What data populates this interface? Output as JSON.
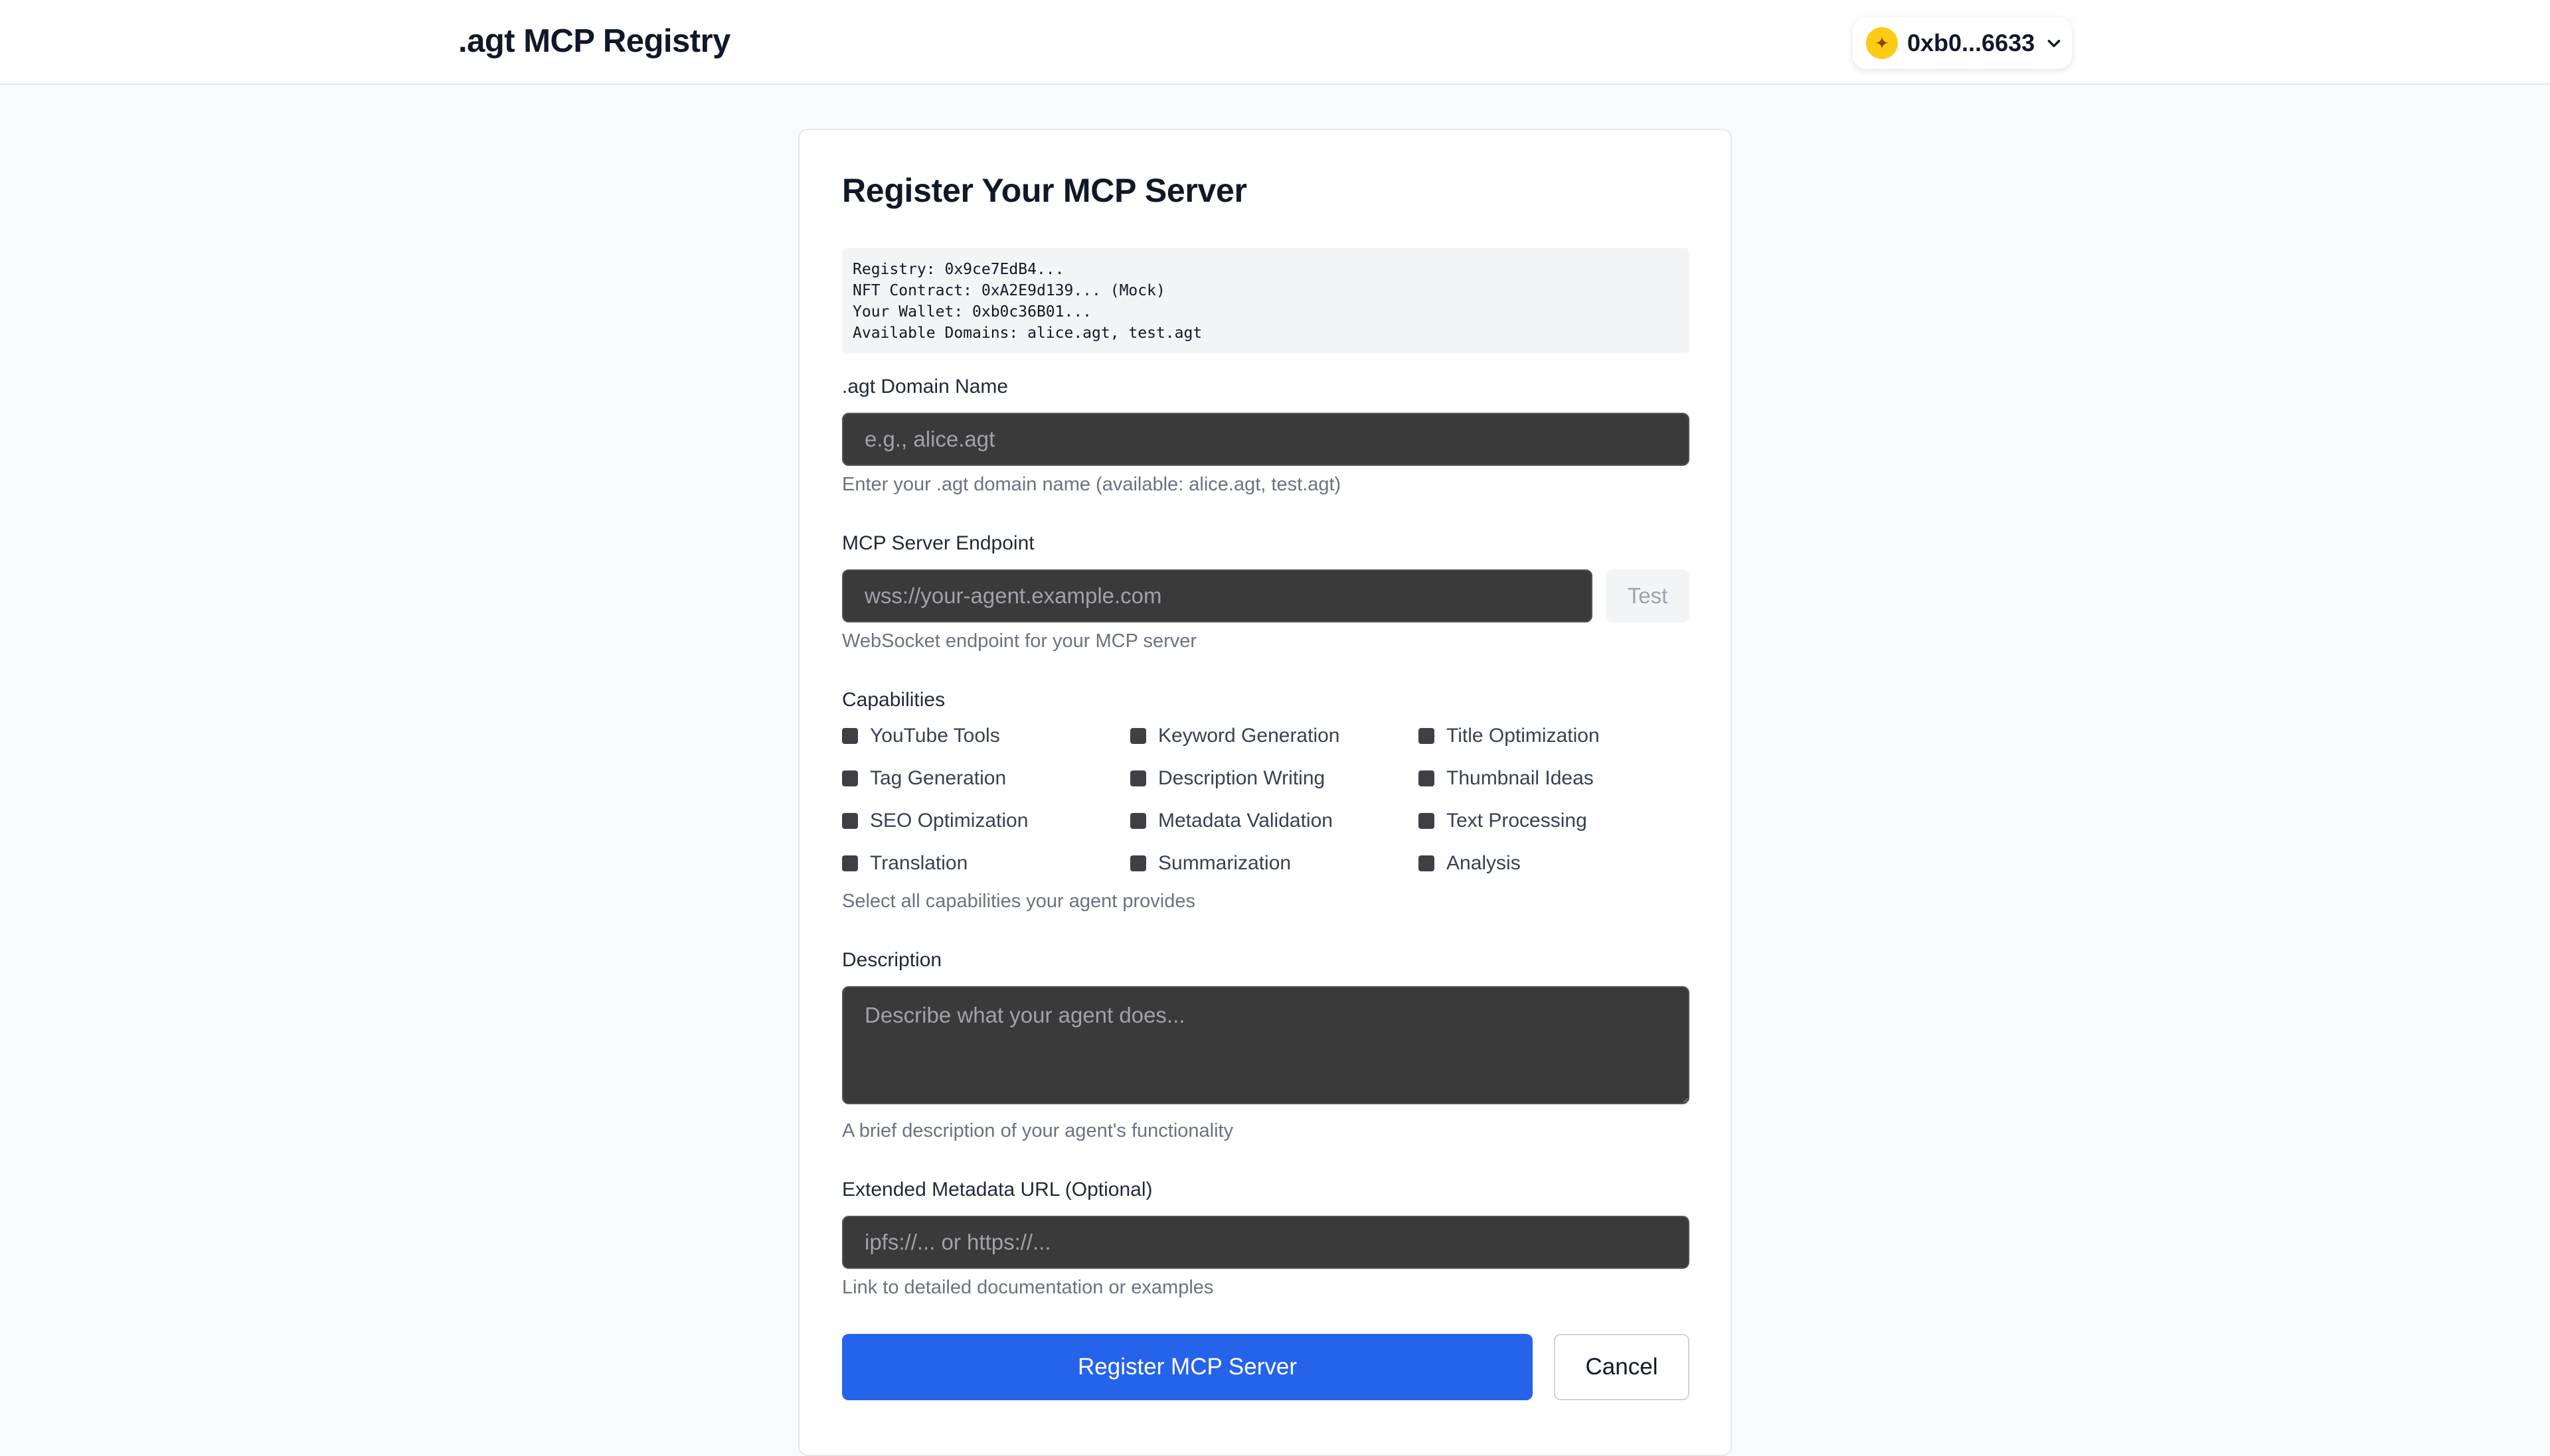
{
  "header": {
    "title": ".agt MCP Registry",
    "wallet": {
      "avatar_icon": "avatar-icon",
      "address": "0xb0...6633",
      "chevron_icon": "chevron-down-icon"
    }
  },
  "form": {
    "title": "Register Your MCP Server",
    "info_lines": [
      "Registry: 0x9ce7EdB4...",
      "NFT Contract: 0xA2E9d139... (Mock)",
      "Your Wallet: 0xb0c36B01...",
      "Available Domains: alice.agt, test.agt"
    ],
    "domain": {
      "label": ".agt Domain Name",
      "placeholder": "e.g., alice.agt",
      "value": "",
      "hint": "Enter your .agt domain name (available: alice.agt, test.agt)"
    },
    "endpoint": {
      "label": "MCP Server Endpoint",
      "placeholder": "wss://your-agent.example.com",
      "value": "",
      "test_label": "Test",
      "hint": "WebSocket endpoint for your MCP server"
    },
    "capabilities": {
      "label": "Capabilities",
      "items": [
        "YouTube Tools",
        "Keyword Generation",
        "Title Optimization",
        "Tag Generation",
        "Description Writing",
        "Thumbnail Ideas",
        "SEO Optimization",
        "Metadata Validation",
        "Text Processing",
        "Translation",
        "Summarization",
        "Analysis"
      ],
      "hint": "Select all capabilities your agent provides"
    },
    "description": {
      "label": "Description",
      "placeholder": "Describe what your agent does...",
      "value": "",
      "hint": "A brief description of your agent's functionality"
    },
    "metadata": {
      "label": "Extended Metadata URL (Optional)",
      "placeholder": "ipfs://... or https://...",
      "value": "",
      "hint": "Link to detailed documentation or examples"
    },
    "submit_label": "Register MCP Server",
    "cancel_label": "Cancel"
  },
  "colors": {
    "primary": "#2563eb",
    "input_bg": "#3a3a3a",
    "page_bg": "#f9fafb"
  }
}
